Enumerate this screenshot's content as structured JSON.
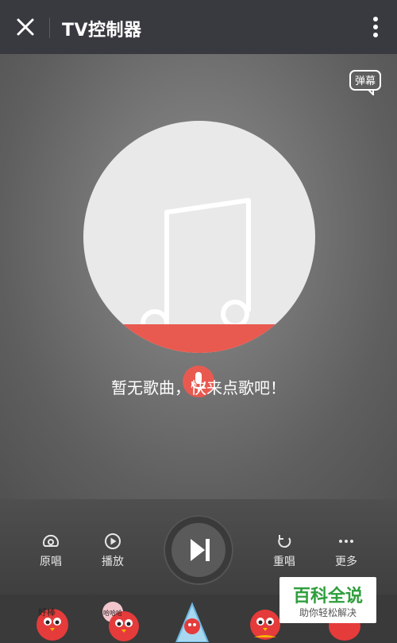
{
  "topbar": {
    "title": "TV控制器",
    "close_icon": "close-icon",
    "menu_icon": "more-vertical-icon"
  },
  "stage": {
    "danmu_label": "弹幕",
    "empty_message": "暂无歌曲，快来点歌吧！",
    "disc_icon": "music-note-icon",
    "mic_icon": "microphone-icon",
    "accent": "#e85a50"
  },
  "controls": {
    "original_label": "原唱",
    "play_label": "播放",
    "repeat_label": "重唱",
    "more_label": "更多"
  },
  "stickers": {
    "items": [
      "好棒",
      "哈哈哈",
      "",
      "",
      ""
    ]
  },
  "watermark": {
    "title": "百科全说",
    "subtitle": "助你轻松解决"
  }
}
